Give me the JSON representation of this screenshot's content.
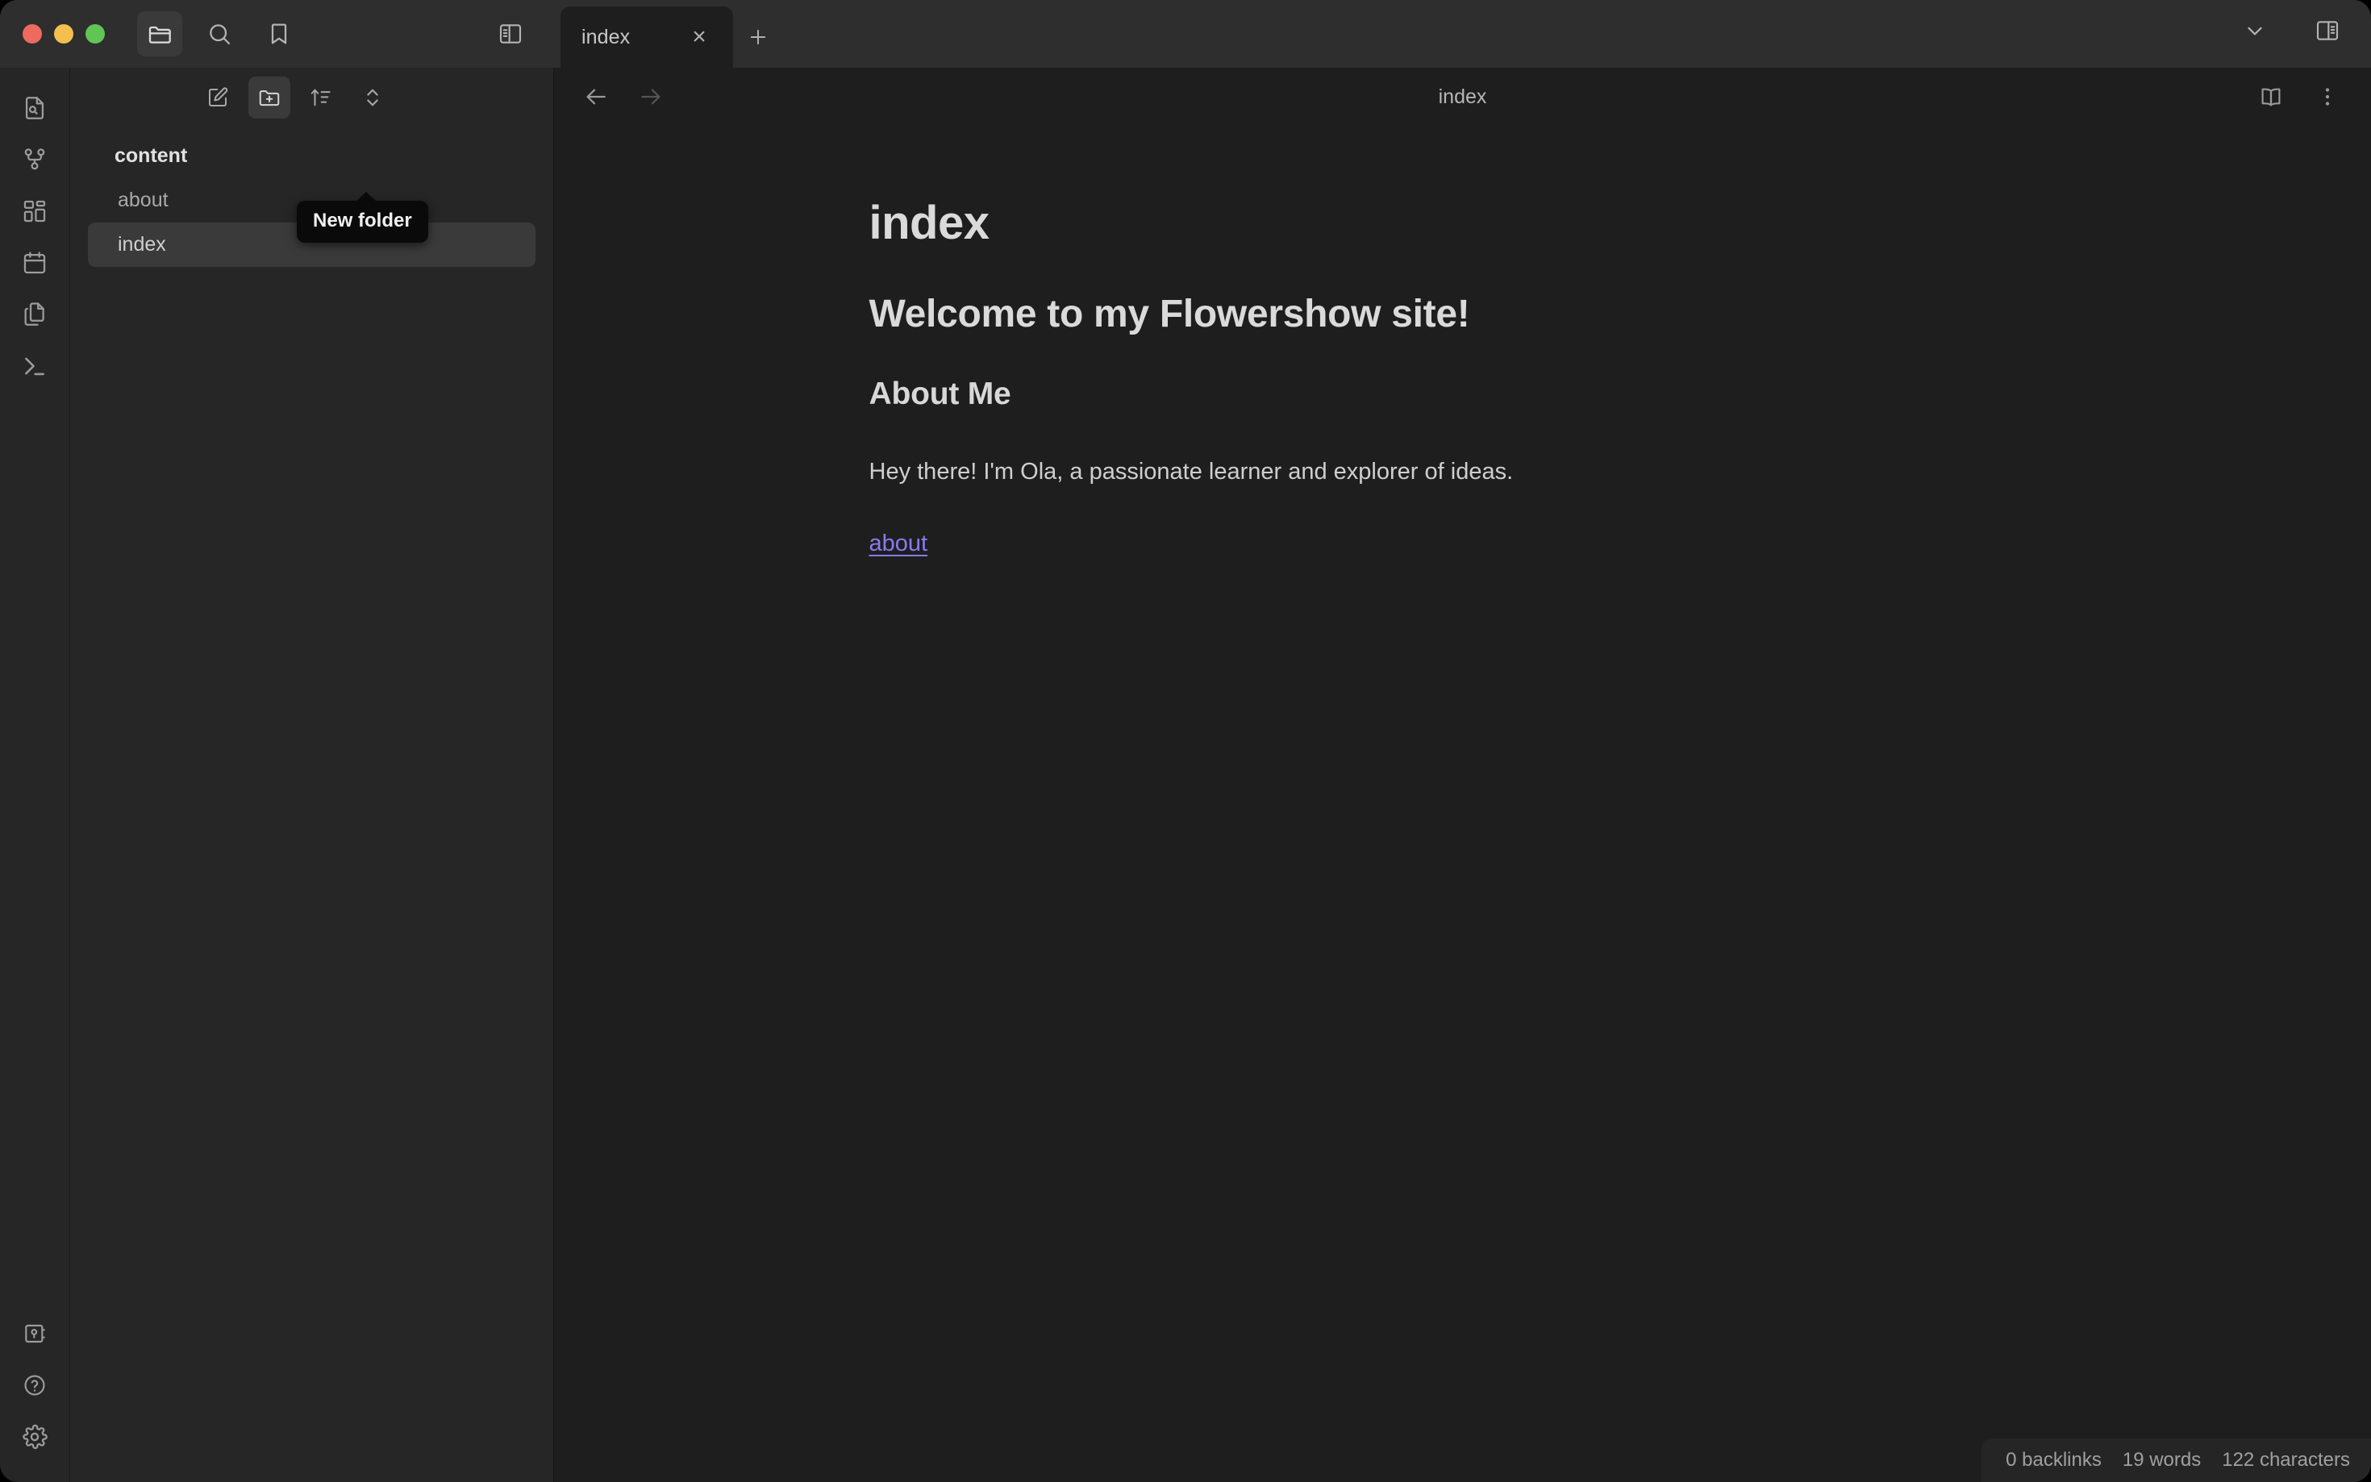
{
  "window": {
    "traffic_lights": [
      "close",
      "minimize",
      "maximize"
    ],
    "colors": {
      "titlebar_bg": "#2e2e2e",
      "sidebar_bg": "#262626",
      "main_bg": "#1e1e1e",
      "accent_link": "#8a7af0",
      "selection_bg": "#3a3a3a",
      "tooltip_bg": "#0a0a0a",
      "traffic_red": "#ed6a5f",
      "traffic_yellow": "#f5bf4f",
      "traffic_green": "#61c555"
    }
  },
  "titlebar": {
    "left_icons": [
      {
        "name": "folder-open-icon",
        "label": "Files",
        "active": true
      },
      {
        "name": "search-icon",
        "label": "Search",
        "active": false
      },
      {
        "name": "bookmark-icon",
        "label": "Bookmarks",
        "active": false
      }
    ],
    "left_sidebar_toggle": {
      "name": "toggle-left-sidebar-icon",
      "label": "Toggle left sidebar"
    },
    "right_sidebar_toggle": {
      "name": "toggle-right-sidebar-icon",
      "label": "Toggle right sidebar"
    },
    "tab_list_chevron": {
      "name": "chevron-down-icon",
      "label": "Tab list"
    }
  },
  "tabs": {
    "items": [
      {
        "title": "index",
        "active": true,
        "close_label": "×"
      }
    ],
    "new_tab_label": "+"
  },
  "ribbon": {
    "top_items": [
      {
        "name": "file-search-icon",
        "label": "Quick switcher"
      },
      {
        "name": "graph-view-icon",
        "label": "Open graph view"
      },
      {
        "name": "canvas-grid-icon",
        "label": "Create new canvas"
      },
      {
        "name": "calendar-icon",
        "label": "Open daily note"
      },
      {
        "name": "copy-files-icon",
        "label": "Templates"
      },
      {
        "name": "terminal-icon",
        "label": "Terminal"
      }
    ],
    "bottom_items": [
      {
        "name": "vault-switcher-icon",
        "label": "Open another vault"
      },
      {
        "name": "help-icon",
        "label": "Help"
      },
      {
        "name": "settings-gear-icon",
        "label": "Settings"
      }
    ]
  },
  "explorer": {
    "toolbar": [
      {
        "name": "new-note-icon",
        "label": "New note",
        "active": false
      },
      {
        "name": "new-folder-icon",
        "label": "New folder",
        "active": true
      },
      {
        "name": "sort-order-icon",
        "label": "Change sort order",
        "active": false
      },
      {
        "name": "collapse-expand-icon",
        "label": "Expand all",
        "active": false
      }
    ],
    "tooltip": {
      "text": "New folder",
      "visible": true
    },
    "tree": [
      {
        "label": "content",
        "type": "folder",
        "selected": false
      },
      {
        "label": "about",
        "type": "file",
        "selected": false
      },
      {
        "label": "index",
        "type": "file",
        "selected": true
      }
    ]
  },
  "view_header": {
    "back": {
      "name": "back-arrow-icon",
      "label": "Navigate back",
      "disabled": false
    },
    "forward": {
      "name": "forward-arrow-icon",
      "label": "Navigate forward",
      "disabled": true
    },
    "title": "index",
    "reading_view": {
      "name": "book-open-icon",
      "label": "Reading view"
    },
    "more_options": {
      "name": "more-options-icon",
      "label": "More options"
    }
  },
  "document": {
    "title": "index",
    "heading_1": "Welcome to my Flowershow site!",
    "heading_2": "About Me",
    "paragraph": "Hey there! I'm Ola, a passionate learner and explorer of ideas.",
    "link": "about"
  },
  "status_bar": {
    "backlinks": "0 backlinks",
    "words": "19 words",
    "characters": "122 characters"
  }
}
